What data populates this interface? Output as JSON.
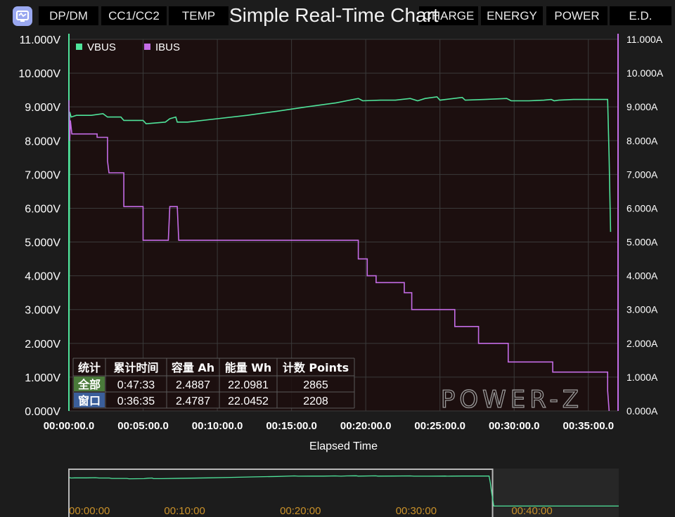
{
  "toolbar": {
    "tabs": [
      {
        "label": "DP/DM"
      },
      {
        "label": "CC1/CC2"
      },
      {
        "label": "TEMP"
      },
      {
        "label": "CHARGE"
      },
      {
        "label": "ENERGY"
      },
      {
        "label": "POWER"
      },
      {
        "label": "E.D."
      }
    ]
  },
  "chart_data": {
    "type": "line",
    "title": "Simple Real-Time Chart",
    "xlabel": "Elapsed Time",
    "x_unit": "minutes",
    "xlim": [
      0,
      37
    ],
    "x_ticks": [
      {
        "value": 0,
        "label": "00:00:00.0"
      },
      {
        "value": 5,
        "label": "00:05:00.0"
      },
      {
        "value": 10,
        "label": "00:10:00.0"
      },
      {
        "value": 15,
        "label": "00:15:00.0"
      },
      {
        "value": 20,
        "label": "00:20:00.0"
      },
      {
        "value": 25,
        "label": "00:25:00.0"
      },
      {
        "value": 30,
        "label": "00:30:00.0"
      },
      {
        "value": 35,
        "label": "00:35:00.0"
      }
    ],
    "y_left": {
      "unit": "V",
      "ylim": [
        0,
        11
      ],
      "ticks": [
        "0.000V",
        "1.000V",
        "2.000V",
        "3.000V",
        "4.000V",
        "5.000V",
        "6.000V",
        "7.000V",
        "8.000V",
        "9.000V",
        "10.000V",
        "11.000V"
      ]
    },
    "y_right": {
      "unit": "A",
      "ylim": [
        0,
        11
      ],
      "ticks": [
        "0.000A",
        "1.000A",
        "2.000A",
        "3.000A",
        "4.000A",
        "5.000A",
        "6.000A",
        "7.000A",
        "8.000A",
        "9.000A",
        "10.000A",
        "11.000A"
      ]
    },
    "grid": true,
    "legend": "top-left",
    "series": [
      {
        "name": "VBUS",
        "axis": "left",
        "color": "#4fe39a",
        "points": [
          [
            0,
            0
          ],
          [
            0.05,
            8.85
          ],
          [
            0.15,
            8.7
          ],
          [
            0.5,
            8.75
          ],
          [
            1.5,
            8.75
          ],
          [
            2.3,
            8.8
          ],
          [
            2.6,
            8.7
          ],
          [
            3.5,
            8.7
          ],
          [
            3.7,
            8.6
          ],
          [
            5,
            8.6
          ],
          [
            5.2,
            8.5
          ],
          [
            6.5,
            8.55
          ],
          [
            6.8,
            8.65
          ],
          [
            7.2,
            8.7
          ],
          [
            7.3,
            8.55
          ],
          [
            8,
            8.55
          ],
          [
            10,
            8.65
          ],
          [
            12,
            8.75
          ],
          [
            14,
            8.87
          ],
          [
            16,
            9.0
          ],
          [
            18,
            9.12
          ],
          [
            19.5,
            9.25
          ],
          [
            19.8,
            9.18
          ],
          [
            21,
            9.2
          ],
          [
            22,
            9.2
          ],
          [
            23,
            9.25
          ],
          [
            23.5,
            9.18
          ],
          [
            24,
            9.25
          ],
          [
            24.8,
            9.3
          ],
          [
            25,
            9.2
          ],
          [
            26.5,
            9.28
          ],
          [
            26.7,
            9.2
          ],
          [
            28,
            9.22
          ],
          [
            29.5,
            9.25
          ],
          [
            29.8,
            9.18
          ],
          [
            31,
            9.18
          ],
          [
            32,
            9.2
          ],
          [
            32.5,
            9.22
          ],
          [
            32.7,
            9.18
          ],
          [
            33,
            9.2
          ],
          [
            34,
            9.22
          ],
          [
            35,
            9.22
          ],
          [
            36.3,
            9.22
          ],
          [
            36.4,
            7.5
          ],
          [
            36.5,
            5.3
          ]
        ]
      },
      {
        "name": "IBUS",
        "axis": "right",
        "color": "#c46ce6",
        "points": [
          [
            0,
            9.2
          ],
          [
            0.05,
            8.0
          ],
          [
            0.1,
            8.6
          ],
          [
            0.2,
            8.2
          ],
          [
            1.9,
            8.2
          ],
          [
            1.9,
            8.1
          ],
          [
            2.6,
            8.1
          ],
          [
            2.6,
            7.4
          ],
          [
            2.7,
            7.05
          ],
          [
            3.7,
            7.05
          ],
          [
            3.7,
            6.05
          ],
          [
            5,
            6.05
          ],
          [
            5,
            5.05
          ],
          [
            6.7,
            5.05
          ],
          [
            6.8,
            6.05
          ],
          [
            7.3,
            6.05
          ],
          [
            7.4,
            5.05
          ],
          [
            19.5,
            5.05
          ],
          [
            19.5,
            4.5
          ],
          [
            20.1,
            4.5
          ],
          [
            20.1,
            4.0
          ],
          [
            20.7,
            4.0
          ],
          [
            20.7,
            3.8
          ],
          [
            22.6,
            3.8
          ],
          [
            22.6,
            3.5
          ],
          [
            23.1,
            3.5
          ],
          [
            23.1,
            3.0
          ],
          [
            26,
            3.0
          ],
          [
            26,
            2.5
          ],
          [
            27.6,
            2.5
          ],
          [
            27.6,
            2.0
          ],
          [
            29.6,
            2.0
          ],
          [
            29.6,
            1.45
          ],
          [
            32.6,
            1.45
          ],
          [
            32.6,
            1.15
          ],
          [
            36.3,
            1.15
          ],
          [
            36.3,
            0.6
          ],
          [
            36.4,
            0
          ]
        ]
      }
    ],
    "stats_table": {
      "headers": [
        "统计",
        "累计时间",
        "容量 Ah",
        "能量 Wh",
        "计数 Points"
      ],
      "rows": [
        {
          "label": "全部",
          "label_color": "#4a7a3a",
          "values": [
            "0:47:33",
            "2.4887",
            "22.0981",
            "2865"
          ]
        },
        {
          "label": "窗口",
          "label_color": "#3b5e9a",
          "values": [
            "0:36:35",
            "2.4787",
            "22.0452",
            "2208"
          ]
        }
      ]
    },
    "watermark": "POWER-Z"
  },
  "navigator": {
    "tick_labels": [
      "00:00:00",
      "00:10:00",
      "00:20:00",
      "00:30:00",
      "00:40:00"
    ],
    "window_min": [
      0,
      36.6
    ]
  },
  "colors": {
    "plot_bg": "#1c0f0f",
    "grid": "#3a3a3a",
    "vbus": "#4fe39a",
    "ibus": "#c46ce6",
    "nav_tick": "#c8902a"
  }
}
